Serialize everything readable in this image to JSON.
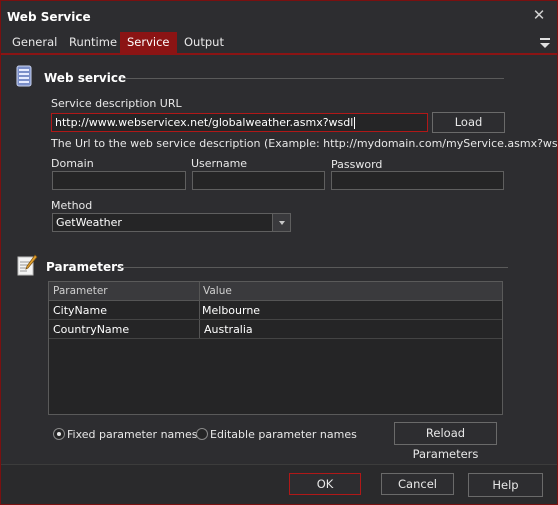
{
  "window": {
    "title": "Web Service",
    "close_icon": "close-icon"
  },
  "tabs": [
    {
      "label": "General",
      "active": false
    },
    {
      "label": "Runtime",
      "active": false
    },
    {
      "label": "Service",
      "active": true
    },
    {
      "label": "Output",
      "active": false
    }
  ],
  "colors": {
    "accent": "#8b1414",
    "background": "#2d2d30",
    "field": "#252526"
  },
  "webservice": {
    "title": "Web service",
    "url_label": "Service description URL",
    "url_value": "http://www.webservicex.net/globalweather.asmx?wsdl",
    "load_label": "Load",
    "url_help": "The Url to the web service description (Example: http://mydomain.com/myService.asmx?wsdl)",
    "domain_label": "Domain",
    "domain_value": "",
    "username_label": "Username",
    "username_value": "",
    "password_label": "Password",
    "password_value": "",
    "method_label": "Method",
    "method_value": "GetWeather"
  },
  "parameters": {
    "title": "Parameters",
    "columns": [
      "Parameter",
      "Value"
    ],
    "rows": [
      {
        "parameter": "CityName",
        "value": "Melbourne"
      },
      {
        "parameter": "CountryName",
        "value": "Australia"
      }
    ],
    "fixed_label": "Fixed parameter names",
    "fixed_checked": true,
    "editable_label": "Editable parameter names",
    "editable_checked": false,
    "reload_label": "Reload Parameters"
  },
  "footer": {
    "ok_label": "OK",
    "cancel_label": "Cancel",
    "help_label": "Help"
  }
}
